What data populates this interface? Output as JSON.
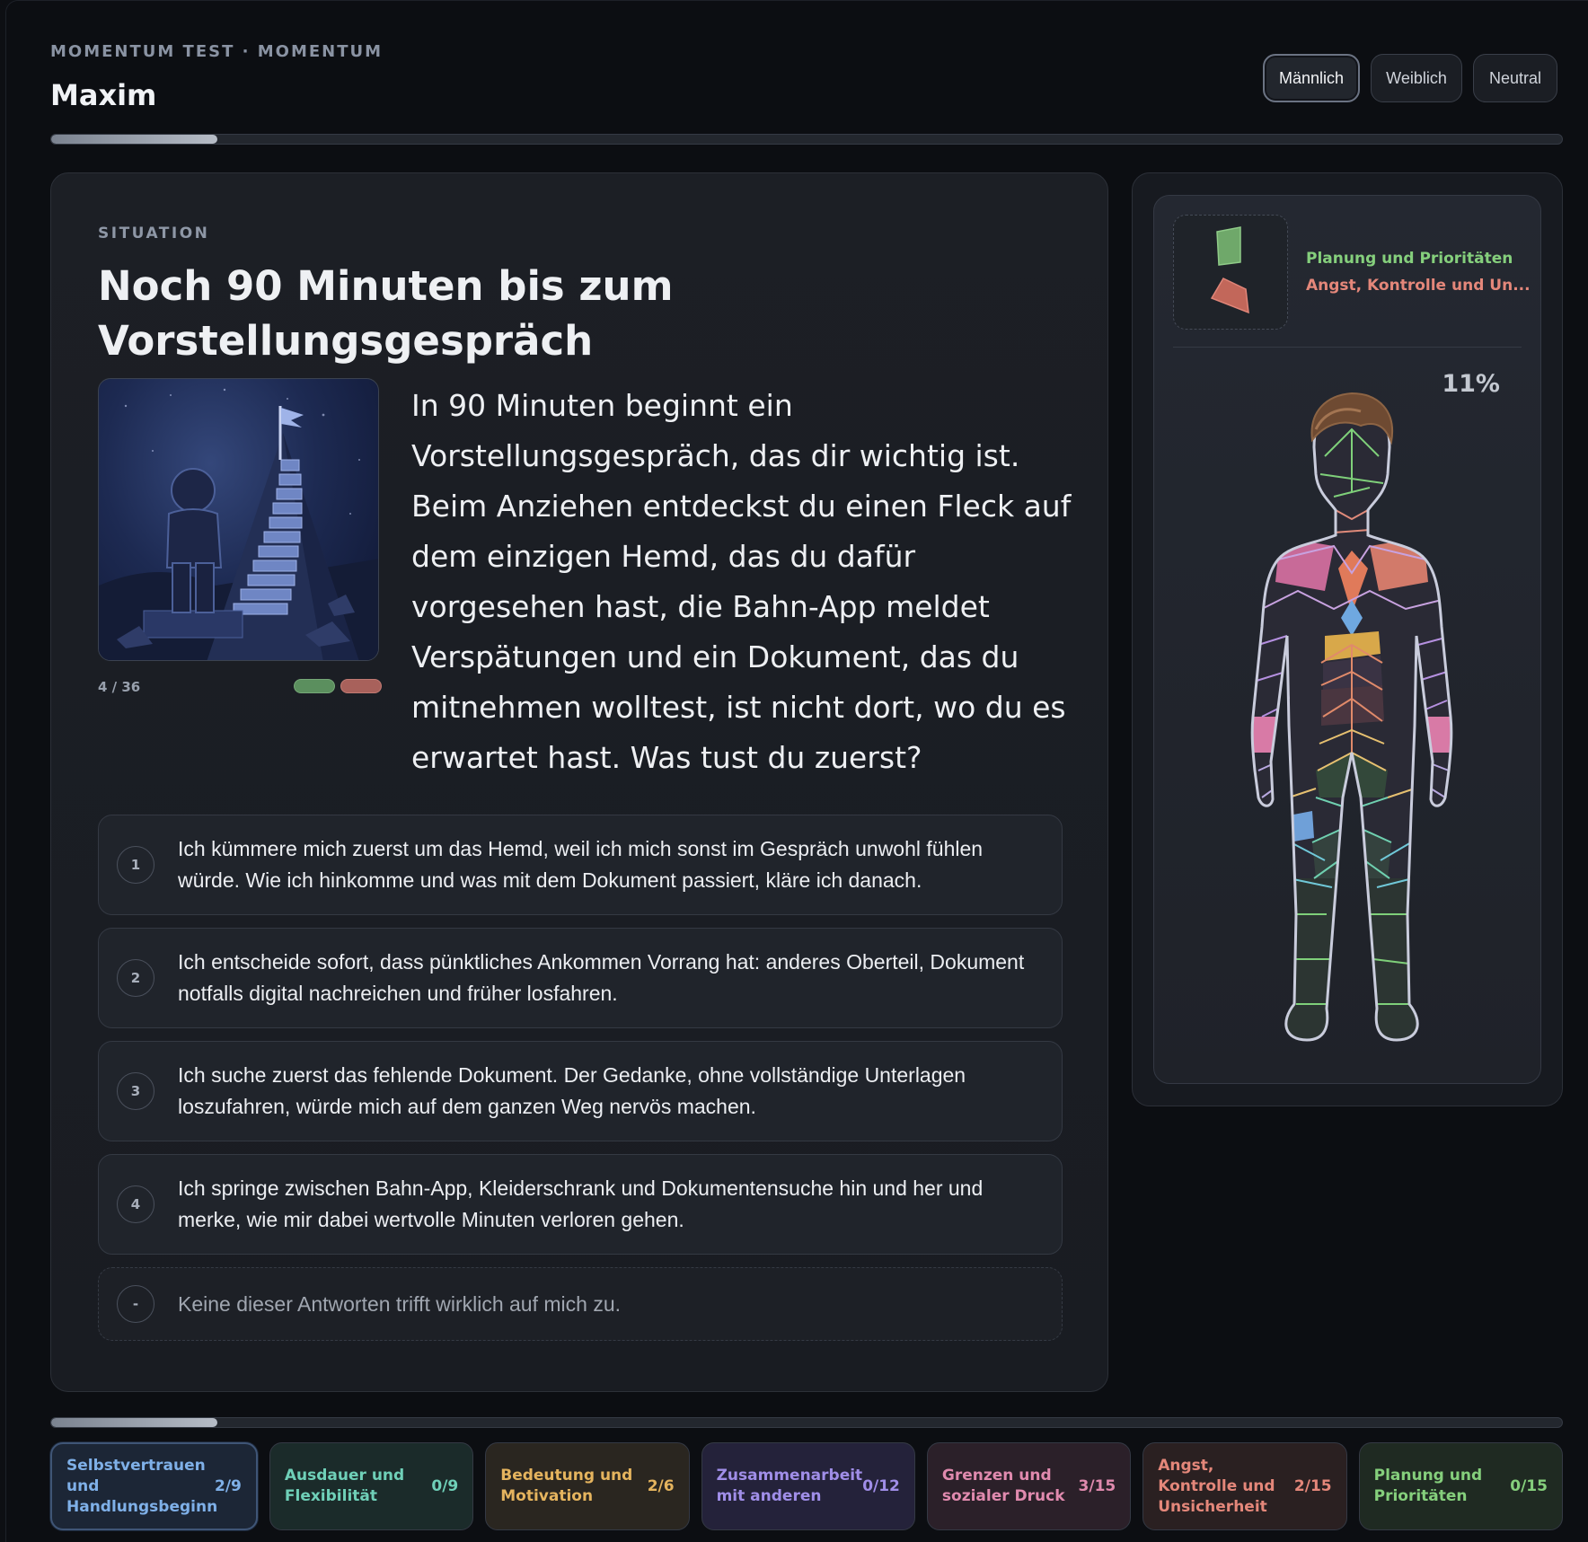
{
  "header": {
    "eyebrow": "MOMENTUM TEST · MOMENTUM",
    "username": "Maxim",
    "gender_options": [
      "Männlich",
      "Weiblich",
      "Neutral"
    ],
    "gender_selected": "Männlich"
  },
  "progress": {
    "fraction": 0.11
  },
  "situation": {
    "label": "SITUATION",
    "title": "Noch 90 Minuten bis zum Vorstellungsgespräch",
    "counter": "4 / 36",
    "text": "In 90 Minuten beginnt ein Vorstellungsgespräch, das dir wichtig ist. Beim Anziehen entdeckst du einen Fleck auf dem einzigen Hemd, das du dafür vorgesehen hast, die Bahn-App meldet Verspätungen und ein Dokument, das du mitnehmen wolltest, ist nicht dort, wo du es erwartet hast. Was tust du zuerst?",
    "tag_colors": [
      "#5b8f5e",
      "#a8615b"
    ]
  },
  "answers": [
    {
      "num": "1",
      "text": "Ich kümmere mich zuerst um das Hemd, weil ich mich sonst im Gespräch unwohl fühlen würde. Wie ich hinkomme und was mit dem Dokument passiert, kläre ich danach."
    },
    {
      "num": "2",
      "text": "Ich entscheide sofort, dass pünktliches Ankommen Vorrang hat: anderes Oberteil, Dokument notfalls digital nachreichen und früher losfahren."
    },
    {
      "num": "3",
      "text": "Ich suche zuerst das fehlende Dokument. Der Gedanke, ohne vollständige Unterlagen loszufahren, würde mich auf dem ganzen Weg nervös machen."
    },
    {
      "num": "4",
      "text": "Ich springe zwischen Bahn-App, Kleiderschrank und Dokumentensuche hin und her und merke, wie mir dabei wertvolle Minuten verloren gehen."
    }
  ],
  "none_option": {
    "num": "-",
    "text": "Keine dieser Antworten trifft wirklich auf mich zu."
  },
  "sidebar": {
    "legend": [
      {
        "label": "Planung und Prioritäten",
        "color": "#85cf7c"
      },
      {
        "label": "Angst, Kontrolle und Un...",
        "color": "#e4877a"
      }
    ],
    "percent": "11%"
  },
  "categories": [
    {
      "label": "Selbstvertrauen und Handlungsbeginn",
      "count": "2/9",
      "color": "#7fb0e8",
      "bg": "#1c2636",
      "active": true
    },
    {
      "label": "Ausdauer und Flexibilität",
      "count": "0/9",
      "color": "#6fd0b8",
      "bg": "#1b2b2a",
      "active": false
    },
    {
      "label": "Bedeutung und Motivation",
      "count": "2/6",
      "color": "#e5b45e",
      "bg": "#2a2620",
      "active": false
    },
    {
      "label": "Zusammenarbeit mit anderen",
      "count": "0/12",
      "color": "#a08ee8",
      "bg": "#24223a",
      "active": false
    },
    {
      "label": "Grenzen und sozialer Druck",
      "count": "3/15",
      "color": "#e08aae",
      "bg": "#2b2029",
      "active": false
    },
    {
      "label": "Angst, Kontrolle und Unsicherheit",
      "count": "2/15",
      "color": "#e4877a",
      "bg": "#2a2021",
      "active": false
    },
    {
      "label": "Planung und Prioritäten",
      "count": "0/15",
      "color": "#85cf7c",
      "bg": "#1f2a22",
      "active": false
    }
  ]
}
